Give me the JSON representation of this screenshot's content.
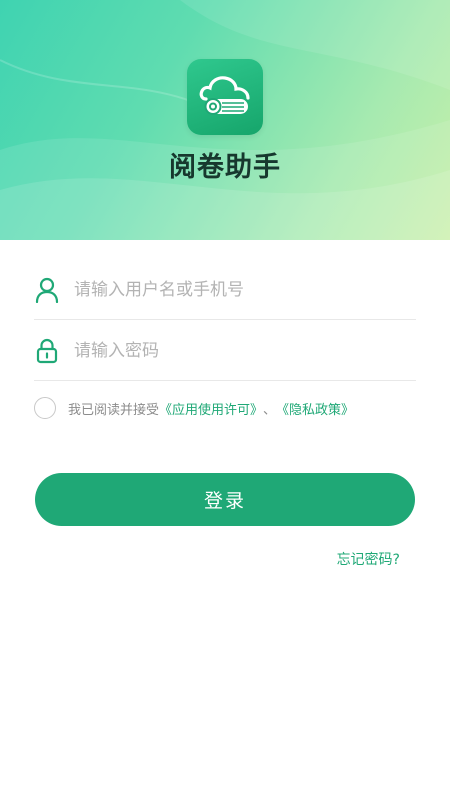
{
  "app": {
    "title": "阅卷助手",
    "icon": "cloud-scroll-icon"
  },
  "colors": {
    "accent": "#1fa876",
    "title": "#17382e",
    "placeholder": "#b3b3b3"
  },
  "form": {
    "username_placeholder": "请输入用户名或手机号",
    "password_placeholder": "请输入密码",
    "user_icon": "user-icon",
    "lock_icon": "lock-icon"
  },
  "agreement": {
    "prefix": "我已阅读并接受",
    "license_link": "《应用使用许可》",
    "separator": "、",
    "privacy_link": "《隐私政策》"
  },
  "actions": {
    "login_label": "登录",
    "forgot_label": "忘记密码?"
  }
}
